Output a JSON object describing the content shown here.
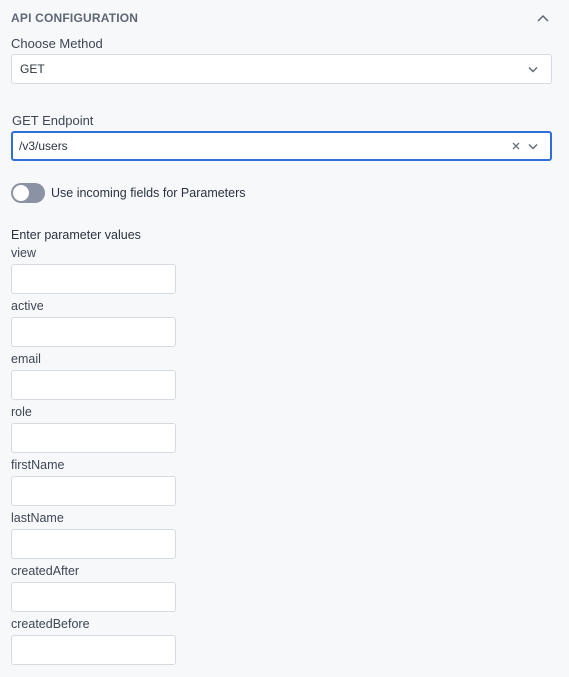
{
  "section": {
    "title": "API CONFIGURATION"
  },
  "method": {
    "label": "Choose Method",
    "value": "GET"
  },
  "endpoint": {
    "label": "GET Endpoint",
    "value": "/v3/users"
  },
  "toggle": {
    "label": "Use incoming fields for Parameters",
    "state": "off"
  },
  "parameters": {
    "heading": "Enter parameter values",
    "items": [
      {
        "label": "view",
        "value": ""
      },
      {
        "label": "active",
        "value": ""
      },
      {
        "label": "email",
        "value": ""
      },
      {
        "label": "role",
        "value": ""
      },
      {
        "label": "firstName",
        "value": ""
      },
      {
        "label": "lastName",
        "value": ""
      },
      {
        "label": "createdAfter",
        "value": ""
      },
      {
        "label": "createdBefore",
        "value": ""
      }
    ]
  },
  "colors": {
    "accent": "#2f6fd6",
    "toggle_off": "#8a92a3",
    "border": "#d6dbe2"
  }
}
